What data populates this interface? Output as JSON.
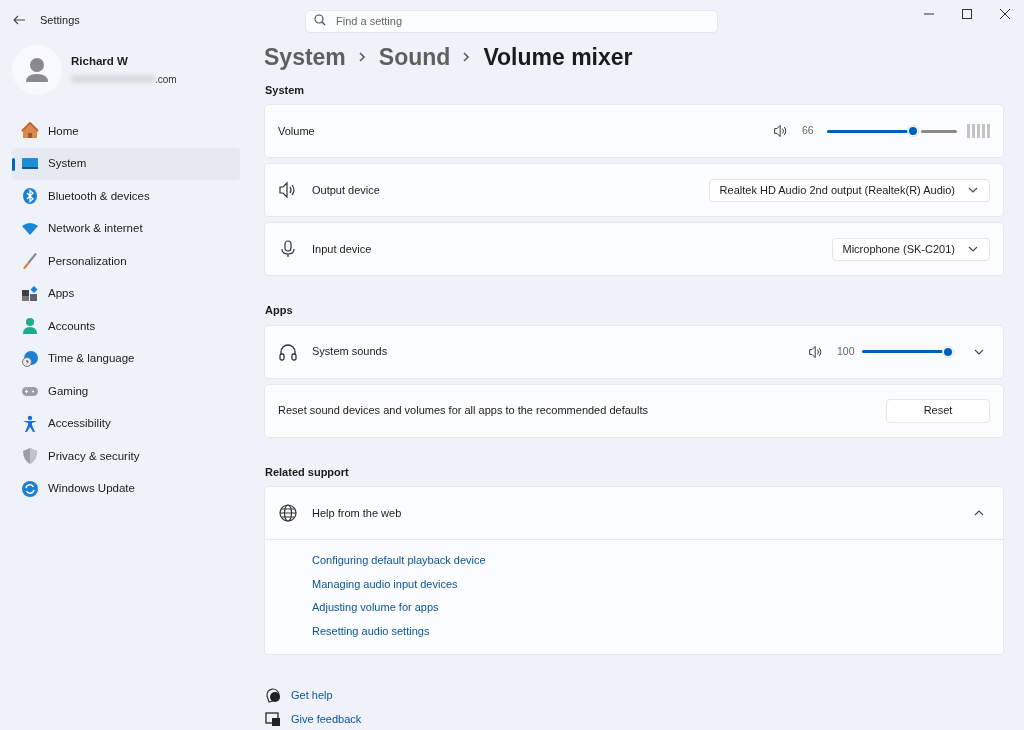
{
  "window": {
    "title": "Settings"
  },
  "search": {
    "placeholder": "Find a setting"
  },
  "user": {
    "name": "Richard W",
    "email": ".com"
  },
  "nav": [
    {
      "label": "Home",
      "selected": false
    },
    {
      "label": "System",
      "selected": true
    },
    {
      "label": "Bluetooth & devices",
      "selected": false
    },
    {
      "label": "Network & internet",
      "selected": false
    },
    {
      "label": "Personalization",
      "selected": false
    },
    {
      "label": "Apps",
      "selected": false
    },
    {
      "label": "Accounts",
      "selected": false
    },
    {
      "label": "Time & language",
      "selected": false
    },
    {
      "label": "Gaming",
      "selected": false
    },
    {
      "label": "Accessibility",
      "selected": false
    },
    {
      "label": "Privacy & security",
      "selected": false
    },
    {
      "label": "Windows Update",
      "selected": false
    }
  ],
  "breadcrumb": [
    "System",
    "Sound",
    "Volume mixer"
  ],
  "sections": [
    {
      "heading": "System",
      "rows": [
        {
          "kind": "slider",
          "label": "Volume",
          "reading": "66",
          "level": 0.66
        },
        {
          "kind": "dropdown",
          "label": "Output device",
          "value": "Realtek HD Audio 2nd output (Realtek(R) Audio)"
        },
        {
          "kind": "dropdown",
          "label": "Input device",
          "value": "Microphone (SK-C201)"
        }
      ]
    },
    {
      "heading": "Apps",
      "rows": [
        {
          "kind": "slider",
          "label": "System sounds",
          "reading": "100",
          "level": 1.0,
          "expanded": false
        },
        {
          "kind": "button",
          "label": "Reset sound devices and volumes for all apps to the recommended defaults",
          "button": "Reset"
        }
      ]
    },
    {
      "heading": "Related support",
      "rows": [
        {
          "kind": "expander",
          "label": "Help from the web",
          "expanded": true,
          "links": [
            "Configuring default playback device",
            "Managing audio input devices",
            "Adjusting volume for apps",
            "Resetting audio settings"
          ]
        }
      ]
    }
  ],
  "footer": [
    {
      "label": "Get help"
    },
    {
      "label": "Give feedback"
    }
  ]
}
